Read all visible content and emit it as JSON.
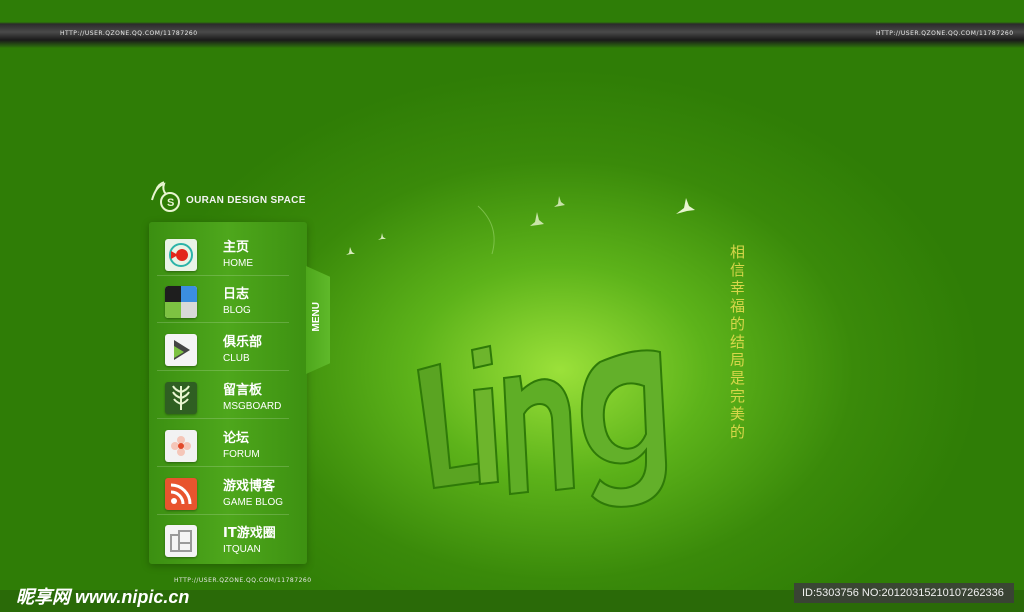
{
  "links": {
    "top_left": "HTTP://USER.QZONE.QQ.COM/11787260",
    "top_right": "HTTP://USER.QZONE.QQ.COM/11787260",
    "bottom": "HTTP://USER.QZONE.QQ.COM/11787260"
  },
  "brand": {
    "name": "OURAN DESIGN SPACE"
  },
  "menu_tab_label": "MENU",
  "menu": [
    {
      "zh": "主页",
      "en": "HOME",
      "icon": "home-icon"
    },
    {
      "zh": "日志",
      "en": "BLOG",
      "icon": "blog-icon"
    },
    {
      "zh": "俱乐部",
      "en": "CLUB",
      "icon": "club-icon"
    },
    {
      "zh": "留言板",
      "en": "MSGBOARD",
      "icon": "msgboard-icon"
    },
    {
      "zh": "论坛",
      "en": "FORUM",
      "icon": "forum-icon"
    },
    {
      "zh": "游戏博客",
      "en": "GAME BLOG",
      "icon": "rss-icon"
    },
    {
      "zh": "IT游戏圈",
      "en": "ITQUAN",
      "icon": "itquan-icon"
    }
  ],
  "hero_word": "Ling",
  "poem": "相信幸福的结局是完美的",
  "watermark": {
    "left": "昵享网 www.nipic.cn",
    "right": "ID:5303756 NO:20120315210107262336"
  },
  "colors": {
    "background": "#3a8a0a",
    "accent": "#4ea71c",
    "poem": "#d6d64a"
  }
}
